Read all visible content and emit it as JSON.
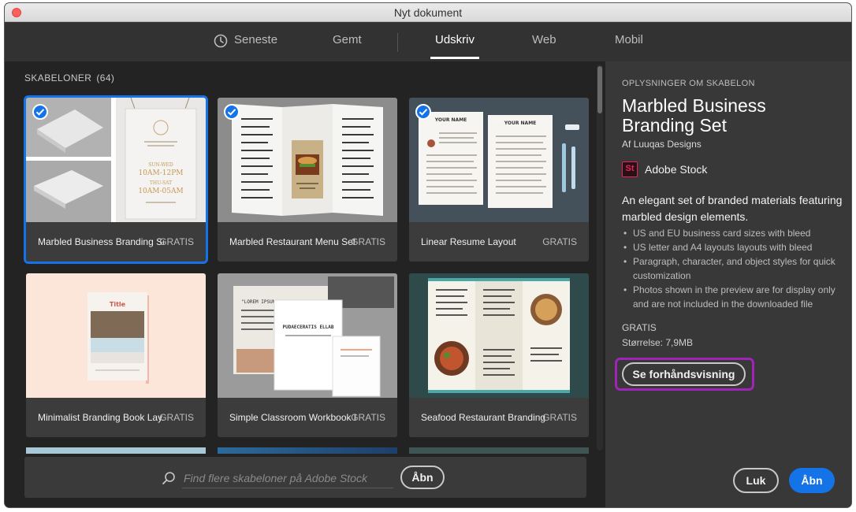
{
  "window": {
    "title": "Nyt dokument"
  },
  "tabs": [
    {
      "label": "Seneste",
      "icon": "clock-icon"
    },
    {
      "label": "Gemt"
    },
    {
      "label": "Udskriv",
      "active": true
    },
    {
      "label": "Web"
    },
    {
      "label": "Mobil"
    }
  ],
  "templates": {
    "heading": "SKABELONER",
    "count": "(64)",
    "items": [
      {
        "name": "Marbled Business Branding Set",
        "price": "GRATIS",
        "selected": true,
        "checked": true
      },
      {
        "name": "Marbled Restaurant Menu Set",
        "price": "GRATIS",
        "checked": true
      },
      {
        "name": "Linear Resume Layout",
        "price": "GRATIS",
        "checked": true
      },
      {
        "name": "Minimalist Branding Book Lay...",
        "price": "GRATIS"
      },
      {
        "name": "Simple Classroom Workbook L...",
        "price": "GRATIS"
      },
      {
        "name": "Seafood Restaurant Branding S...",
        "price": "GRATIS"
      }
    ],
    "thumb_texts": {
      "card1_sign": [
        "SUN-WED",
        "10AM-12PM",
        "THU-SAT",
        "10AM-05AM"
      ],
      "card3_name": "YOUR NAME",
      "card4_title": "Title",
      "card5_left": "\"LOREM IPSUM DOLOR SIT AMET\"",
      "card5_right": "PUDAECERATIS ELLAB"
    }
  },
  "search": {
    "placeholder": "Find flere skabeloner på Adobe Stock",
    "open_label": "Åbn"
  },
  "details": {
    "section_label": "OPLYSNINGER OM SKABELON",
    "title": "Marbled Business Branding Set",
    "author_prefix": "Af",
    "author": "Luuqas Designs",
    "source_logo": "St",
    "source": "Adobe Stock",
    "description": "An elegant set of branded materials featuring marbled design elements.",
    "bullets": [
      "US and EU business card sizes with bleed",
      "US letter and A4 layouts layouts with bleed",
      "Paragraph, character, and object styles for quick customization",
      "Photos shown in the preview are for display only and are not included in the downloaded file"
    ],
    "price": "GRATIS",
    "size": "Størrelse: 7,9MB",
    "preview_label": "Se forhåndsvisning"
  },
  "footer": {
    "close_label": "Luk",
    "open_label": "Åbn"
  },
  "colors": {
    "accent": "#1473e6",
    "highlight": "#a124b8",
    "stock_brand": "#e8245c"
  }
}
